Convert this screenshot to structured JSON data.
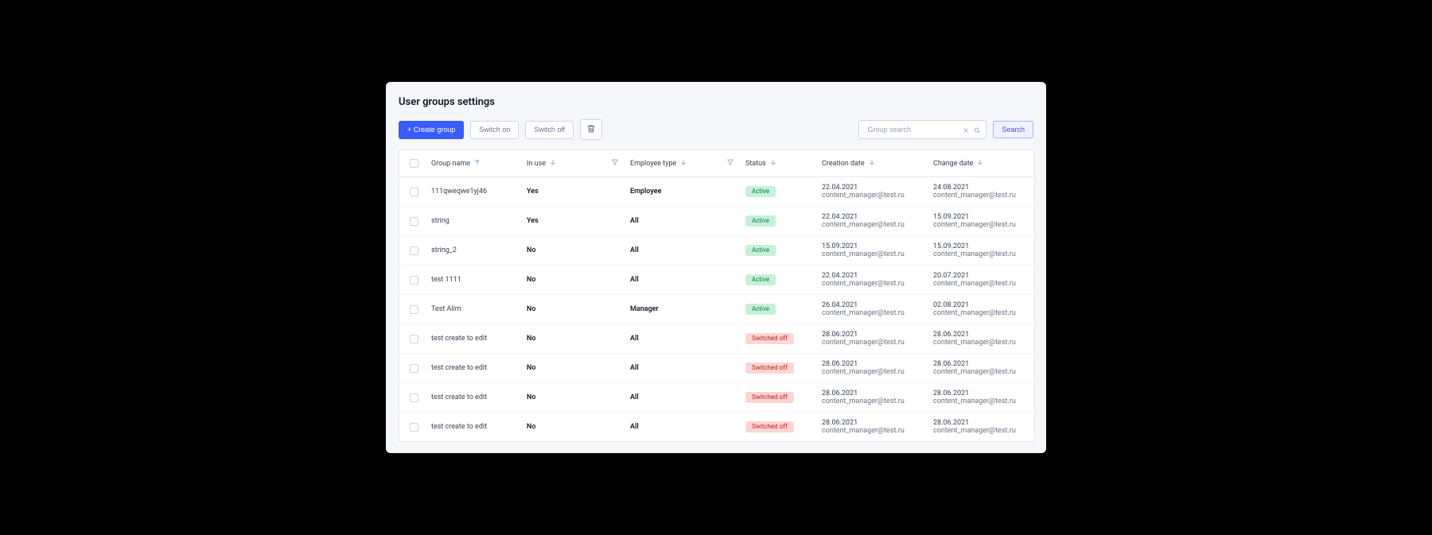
{
  "page": {
    "title": "User groups settings"
  },
  "toolbar": {
    "create_label": "+ Create group",
    "switch_on_label": "Switch on",
    "switch_off_label": "Switch off"
  },
  "search": {
    "placeholder": "Group search",
    "button_label": "Search"
  },
  "columns": {
    "group_name": "Group name",
    "in_use": "In use",
    "employee_type": "Employee type",
    "status": "Status",
    "creation_date": "Creation date",
    "change_date": "Change date"
  },
  "status_labels": {
    "active": "Active",
    "off": "Switched off"
  },
  "rows": [
    {
      "name": "111qweqwe1yj46",
      "in_use": "Yes",
      "emp_type": "Employee",
      "status": "active",
      "created_date": "22.04.2021",
      "created_by": "content_manager@test.ru",
      "changed_date": "24.08.2021",
      "changed_by": "content_manager@test.ru"
    },
    {
      "name": "string",
      "in_use": "Yes",
      "emp_type": "All",
      "status": "active",
      "created_date": "22.04.2021",
      "created_by": "content_manager@test.ru",
      "changed_date": "15.09.2021",
      "changed_by": "content_manager@test.ru"
    },
    {
      "name": "string_2",
      "in_use": "No",
      "emp_type": "All",
      "status": "active",
      "created_date": "15.09.2021",
      "created_by": "content_manager@test.ru",
      "changed_date": "15.09.2021",
      "changed_by": "content_manager@test.ru"
    },
    {
      "name": "test 1111",
      "in_use": "No",
      "emp_type": "All",
      "status": "active",
      "created_date": "22.04.2021",
      "created_by": "content_manager@test.ru",
      "changed_date": "20.07.2021",
      "changed_by": "content_manager@test.ru"
    },
    {
      "name": "Test Alim",
      "in_use": "No",
      "emp_type": "Manager",
      "status": "active",
      "created_date": "26.04.2021",
      "created_by": "content_manager@test.ru",
      "changed_date": "02.08.2021",
      "changed_by": "content_manager@test.ru"
    },
    {
      "name": "test create to edit",
      "in_use": "No",
      "emp_type": "All",
      "status": "off",
      "created_date": "28.06.2021",
      "created_by": "content_manager@test.ru",
      "changed_date": "28.06.2021",
      "changed_by": "content_manager@test.ru"
    },
    {
      "name": "test create to edit",
      "in_use": "No",
      "emp_type": "All",
      "status": "off",
      "created_date": "28.06.2021",
      "created_by": "content_manager@test.ru",
      "changed_date": "28.06.2021",
      "changed_by": "content_manager@test.ru"
    },
    {
      "name": "test create to edit",
      "in_use": "No",
      "emp_type": "All",
      "status": "off",
      "created_date": "28.06.2021",
      "created_by": "content_manager@test.ru",
      "changed_date": "28.06.2021",
      "changed_by": "content_manager@test.ru"
    },
    {
      "name": "test create to edit",
      "in_use": "No",
      "emp_type": "All",
      "status": "off",
      "created_date": "28.06.2021",
      "created_by": "content_manager@test.ru",
      "changed_date": "28.06.2021",
      "changed_by": "content_manager@test.ru"
    }
  ]
}
